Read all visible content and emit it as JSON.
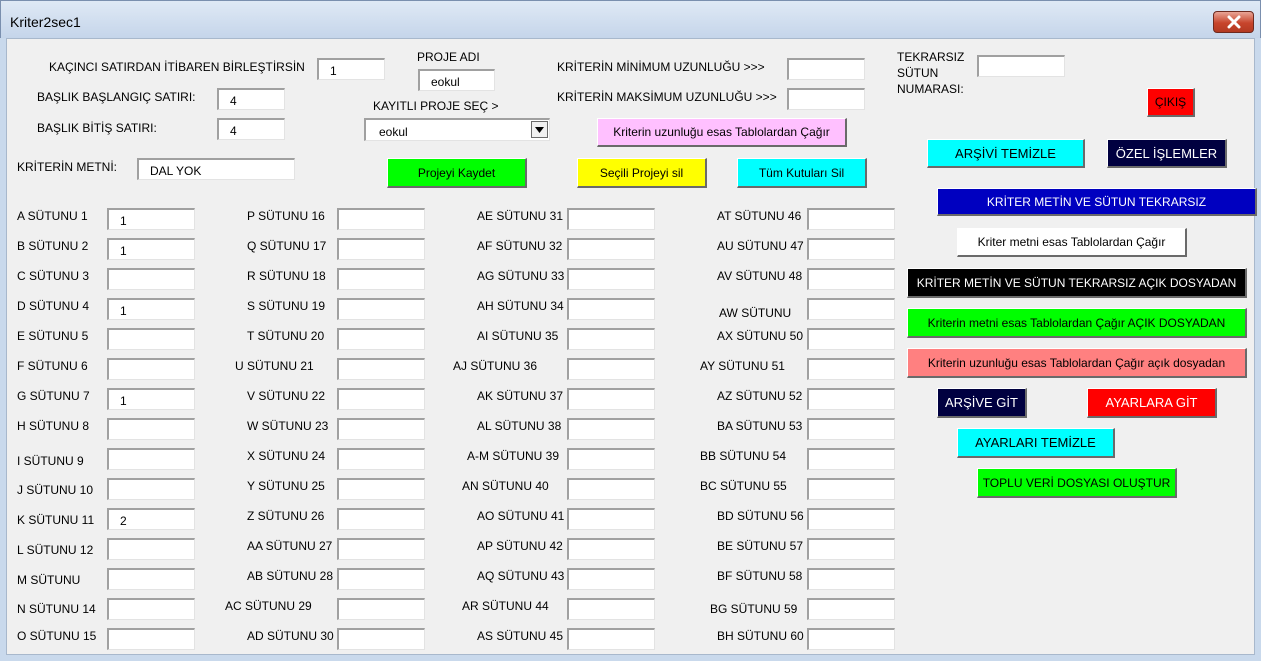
{
  "window": {
    "title": "Kriter2sec1"
  },
  "top": {
    "start_row_label": "KAÇINCI SATIRDAN İTİBAREN BİRLEŞTİRSİN",
    "start_row_value": "1",
    "header_start_label": "BAŞLIK BAŞLANGIÇ SATIRI:",
    "header_start_value": "4",
    "header_end_label": "BAŞLIK BİTİŞ SATIRI:",
    "header_end_value": "4",
    "project_name_label": "PROJE ADI",
    "project_name_value": "eokul",
    "saved_project_label": "KAYITLI PROJE SEÇ >",
    "saved_project_value": "eokul",
    "criteria_min_label": "KRİTERİN MİNİMUM UZUNLUĞU >>>",
    "criteria_min_value": "",
    "criteria_max_label": "KRİTERİN MAKSİMUM UZUNLUĞU >>>",
    "criteria_max_value": "",
    "unique_col_label_1": "TEKRARSIZ",
    "unique_col_label_2": "SÜTUN",
    "unique_col_label_3": "NUMARASI:",
    "unique_col_value": "",
    "criteria_text_label": "KRİTERİN METNİ:",
    "criteria_text_value": "DAL YOK"
  },
  "buttons": {
    "exit": "ÇIKIŞ",
    "length_from_tables": "Kriterin uzunluğu esas Tablolardan Çağır",
    "save_project": "Projeyi Kaydet",
    "delete_project": "Seçili Projeyi sil",
    "clear_all": "Tüm Kutuları Sil",
    "clear_archive": "ARŞİVİ TEMİZLE",
    "special_ops": "ÖZEL İŞLEMLER",
    "criteria_unique": "KRİTER METİN VE SÜTUN TEKRARSIZ",
    "text_from_tables": "Kriter metni esas Tablolardan Çağır",
    "criteria_unique_open": "KRİTER METİN VE SÜTUN TEKRARSIZ  AÇIK DOSYADAN",
    "text_from_tables_open": "Kriterin metni esas Tablolardan Çağır AÇIK DOSYADAN",
    "length_from_tables_open": "Kriterin uzunluğu esas Tablolardan Çağır açık dosyadan",
    "go_archive": "ARŞİVE GİT",
    "go_settings": "AYARLARA GİT",
    "clear_settings": "AYARLARI TEMİZLE",
    "bulk_data_file": "TOPLU VERİ DOSYASI OLUŞTUR"
  },
  "columns": [
    [
      {
        "label": "A SÜTUNU 1",
        "value": "1"
      },
      {
        "label": "B SÜTUNU 2",
        "value": "1"
      },
      {
        "label": "C SÜTUNU 3",
        "value": ""
      },
      {
        "label": "D SÜTUNU 4",
        "value": "1"
      },
      {
        "label": "E SÜTUNU 5",
        "value": ""
      },
      {
        "label": "F SÜTUNU 6",
        "value": ""
      },
      {
        "label": "G SÜTUNU 7",
        "value": "1"
      },
      {
        "label": "H SÜTUNU 8",
        "value": ""
      },
      {
        "label": "I SÜTUNU 9",
        "value": ""
      },
      {
        "label": "J SÜTUNU 10",
        "value": ""
      },
      {
        "label": "K SÜTUNU 11",
        "value": "2"
      },
      {
        "label": "L SÜTUNU 12",
        "value": ""
      },
      {
        "label": "M SÜTUNU",
        "value": ""
      },
      {
        "label": "N SÜTUNU 14",
        "value": ""
      },
      {
        "label": "O SÜTUNU 15",
        "value": ""
      }
    ],
    [
      {
        "label": "P SÜTUNU 16",
        "value": ""
      },
      {
        "label": "Q SÜTUNU 17",
        "value": ""
      },
      {
        "label": "R SÜTUNU 18",
        "value": ""
      },
      {
        "label": "S SÜTUNU 19",
        "value": ""
      },
      {
        "label": "T SÜTUNU 20",
        "value": ""
      },
      {
        "label": "U SÜTUNU 21",
        "value": ""
      },
      {
        "label": "V SÜTUNU 22",
        "value": ""
      },
      {
        "label": "W SÜTUNU 23",
        "value": ""
      },
      {
        "label": "X SÜTUNU 24",
        "value": ""
      },
      {
        "label": "Y SÜTUNU 25",
        "value": ""
      },
      {
        "label": "Z SÜTUNU 26",
        "value": ""
      },
      {
        "label": "AA SÜTUNU 27",
        "value": ""
      },
      {
        "label": "AB SÜTUNU 28",
        "value": ""
      },
      {
        "label": "AC SÜTUNU 29",
        "value": ""
      },
      {
        "label": "AD SÜTUNU 30",
        "value": ""
      }
    ],
    [
      {
        "label": "AE SÜTUNU 31",
        "value": ""
      },
      {
        "label": "AF SÜTUNU 32",
        "value": ""
      },
      {
        "label": "AG SÜTUNU 33",
        "value": ""
      },
      {
        "label": "AH SÜTUNU 34",
        "value": ""
      },
      {
        "label": "AI SÜTUNU 35",
        "value": ""
      },
      {
        "label": "AJ SÜTUNU 36",
        "value": ""
      },
      {
        "label": "AK SÜTUNU 37",
        "value": ""
      },
      {
        "label": "AL SÜTUNU 38",
        "value": ""
      },
      {
        "label": "A-M SÜTUNU 39",
        "value": ""
      },
      {
        "label": "AN SÜTUNU 40",
        "value": ""
      },
      {
        "label": "AO SÜTUNU 41",
        "value": ""
      },
      {
        "label": "AP SÜTUNU 42",
        "value": ""
      },
      {
        "label": "AQ SÜTUNU 43",
        "value": ""
      },
      {
        "label": "AR SÜTUNU 44",
        "value": ""
      },
      {
        "label": "AS SÜTUNU 45",
        "value": ""
      }
    ],
    [
      {
        "label": "AT SÜTUNU 46",
        "value": ""
      },
      {
        "label": "AU SÜTUNU 47",
        "value": ""
      },
      {
        "label": "AV SÜTUNU 48",
        "value": ""
      },
      {
        "label": "AW SÜTUNU",
        "value": ""
      },
      {
        "label": "AX SÜTUNU 50",
        "value": ""
      },
      {
        "label": "AY SÜTUNU 51",
        "value": ""
      },
      {
        "label": "AZ SÜTUNU 52",
        "value": ""
      },
      {
        "label": "BA SÜTUNU 53",
        "value": ""
      },
      {
        "label": "BB SÜTUNU 54",
        "value": ""
      },
      {
        "label": "BC SÜTUNU 55",
        "value": ""
      },
      {
        "label": "BD SÜTUNU 56",
        "value": ""
      },
      {
        "label": "BE SÜTUNU 57",
        "value": ""
      },
      {
        "label": "BF SÜTUNU 58",
        "value": ""
      },
      {
        "label": "BG SÜTUNU 59",
        "value": ""
      },
      {
        "label": "BH SÜTUNU 60",
        "value": ""
      }
    ]
  ],
  "colors": {
    "exit_bg": "#ff0000",
    "pink": "#ffc0ff",
    "green": "#00ff00",
    "yellow": "#ffff00",
    "cyan": "#00ffff",
    "navy": "#000040",
    "blue": "#0000c0",
    "white": "#ffffff",
    "black": "#000000",
    "salmon": "#ff8080",
    "red": "#ff0000"
  }
}
